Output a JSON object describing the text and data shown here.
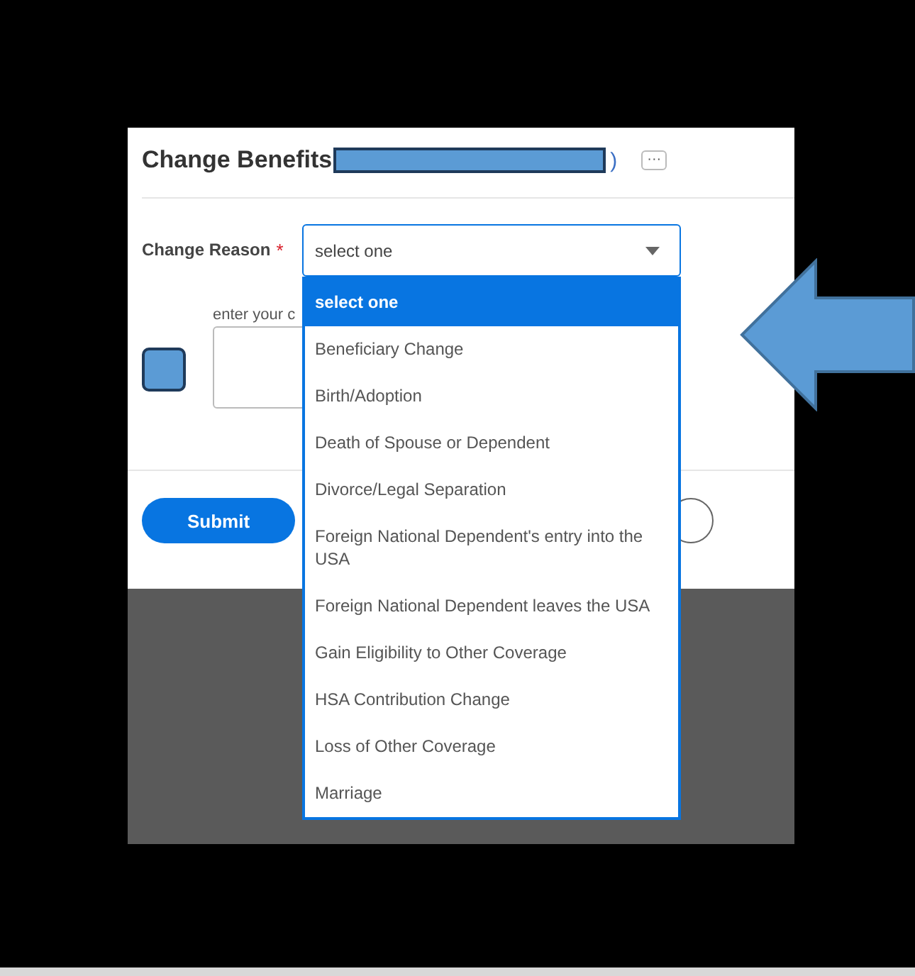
{
  "page": {
    "title": "Change Benefits",
    "title_suffix": ")",
    "more_button": "···"
  },
  "form": {
    "change_reason": {
      "label": "Change Reason",
      "required_mark": "*",
      "value": "select one",
      "expanded": true,
      "options": [
        {
          "label": "select one",
          "selected": true
        },
        {
          "label": "Beneficiary Change",
          "selected": false
        },
        {
          "label": "Birth/Adoption",
          "selected": false
        },
        {
          "label": "Death of Spouse or Dependent",
          "selected": false
        },
        {
          "label": "Divorce/Legal Separation",
          "selected": false
        },
        {
          "label": "Foreign National Dependent's entry into the USA",
          "selected": false
        },
        {
          "label": "Foreign National Dependent leaves the USA",
          "selected": false
        },
        {
          "label": "Gain Eligibility to Other Coverage",
          "selected": false
        },
        {
          "label": "HSA Contribution Change",
          "selected": false
        },
        {
          "label": "Loss of Other Coverage",
          "selected": false
        },
        {
          "label": "Marriage",
          "selected": false
        }
      ]
    },
    "comment": {
      "label": "enter your c"
    }
  },
  "buttons": {
    "submit": "Submit"
  }
}
